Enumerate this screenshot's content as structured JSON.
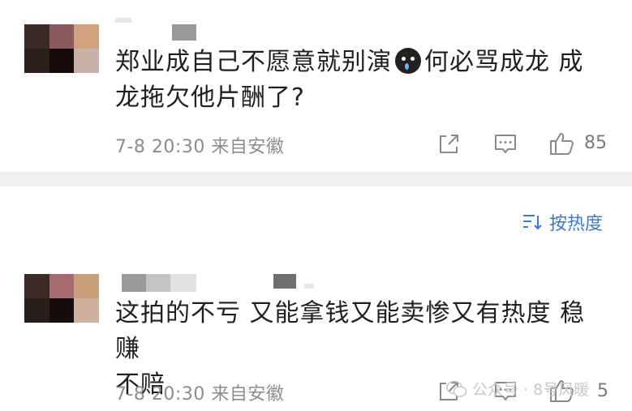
{
  "comments": [
    {
      "text_line1": "郑业成自己不愿意就别演",
      "text_line2_after_emoji": "何必骂成龙 成",
      "text_line3": "龙拖欠他片酬了?",
      "emoji": "crying-face-emoji",
      "date": "7-8 20:30",
      "location": "来自安徽",
      "likes": "85",
      "avatar_colors": [
        "#3a2a25",
        "#8a5a5f",
        "#d2a27e",
        "#2c201c",
        "#140c0b",
        "#c9b0a7"
      ],
      "name_blur_colors": [
        "#d9d9d9",
        "#9a9a9a"
      ]
    },
    {
      "text_line1": "这拍的不亏 又能拿钱又能卖惨又有热度 稳赚",
      "text_line2": "不赔",
      "date": "7-8 20:30",
      "location": "来自安徽",
      "likes": "5",
      "avatar_colors": [
        "#3b2a26",
        "#a56b6f",
        "#c9a07a",
        "#2a1e1b",
        "#150d0c",
        "#cfb09c"
      ],
      "name_blur_colors": [
        "#9b9b9b",
        "#c4c4c4",
        "#e2e2e2",
        "#ffffff",
        "#ffffff",
        "#ffffff",
        "#6f6f6f"
      ]
    }
  ],
  "sort": {
    "label": "按热度",
    "icon": "sort-icon"
  },
  "watermark": {
    "text": "公众号 · 8号风暖",
    "icon": "wechat-icon"
  },
  "colors": {
    "accent": "#3a7ad6",
    "muted": "#8c8c8c",
    "divider": "#f0f0f0"
  }
}
